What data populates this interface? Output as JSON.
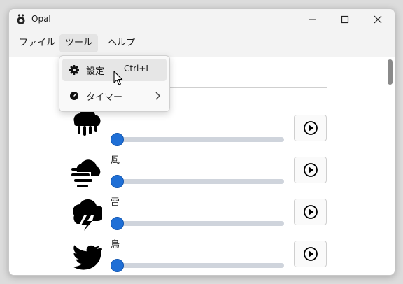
{
  "window": {
    "title": "Opal",
    "controls": [
      "minimize-icon",
      "maximize-icon",
      "close-icon"
    ]
  },
  "menubar": {
    "items": [
      {
        "label": "ファイル"
      },
      {
        "label": "ツール",
        "active": true
      },
      {
        "label": "ヘルプ"
      }
    ]
  },
  "tools_menu": {
    "items": [
      {
        "label": "設定",
        "shortcut": "Ctrl+I",
        "icon": "gear-icon",
        "hovered": true
      },
      {
        "label": "タイマー",
        "icon": "timer-icon",
        "submenu": true
      }
    ]
  },
  "sounds": [
    {
      "label": "",
      "icon": "rain-cloud-icon",
      "volume": 0
    },
    {
      "label": "風",
      "icon": "wind-icon",
      "volume": 0
    },
    {
      "label": "雷",
      "icon": "thunderstorm-icon",
      "volume": 0
    },
    {
      "label": "鳥",
      "icon": "bird-icon",
      "volume": 0
    }
  ],
  "colors": {
    "accent": "#1f6fd6",
    "track": "#cfd4dc",
    "menu_hover": "#e6e6e6"
  }
}
